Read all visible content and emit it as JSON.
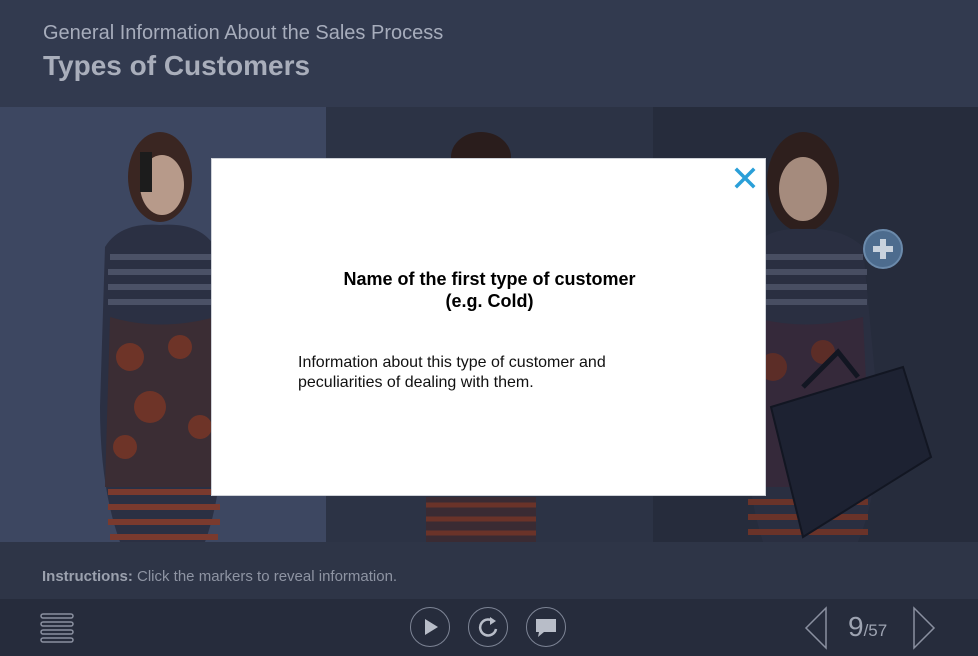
{
  "header": {
    "subtitle": "General Information About the Sales Process",
    "title": "Types of Customers"
  },
  "modal": {
    "heading_line1": "Name of the first type of customer",
    "heading_line2": "(e.g. Cold)",
    "body_line1": "Information about this type of customer and",
    "body_line2": "peculiarities of dealing with them.",
    "close_icon": "close-icon"
  },
  "marker": {
    "icon": "plus-icon"
  },
  "instructions": {
    "label": "Instructions:",
    "text": " Click the markers to reveal information."
  },
  "footer": {
    "menu_icon": "menu-icon",
    "play_icon": "play-icon",
    "replay_icon": "replay-icon",
    "chat_icon": "chat-icon",
    "prev_icon": "chevron-left-icon",
    "next_icon": "chevron-right-icon",
    "current_page": "9",
    "total_pages": "/57"
  },
  "colors": {
    "accent": "#2a9fd8",
    "header_bg": "#323a4f",
    "footer_bg": "#262c3c"
  }
}
